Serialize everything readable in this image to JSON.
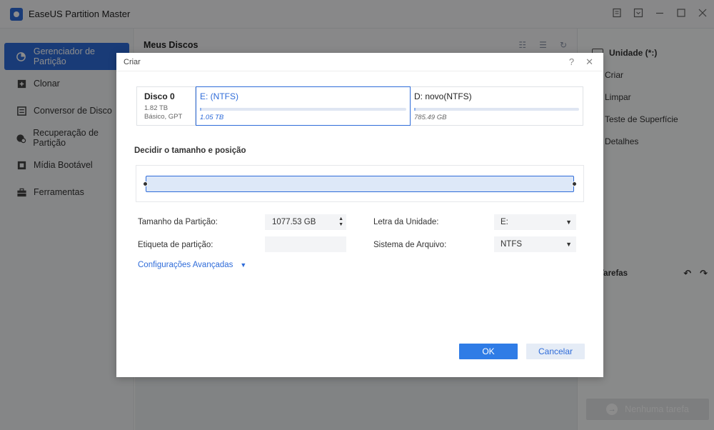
{
  "app": {
    "title": "EaseUS Partition Master"
  },
  "sidebar": {
    "items": [
      {
        "label": "Gerenciador de Partição",
        "icon": "partition-manager-icon",
        "active": true
      },
      {
        "label": "Clonar",
        "icon": "clone-icon"
      },
      {
        "label": "Conversor de Disco",
        "icon": "disk-converter-icon"
      },
      {
        "label": "Recuperação de Partição",
        "icon": "partition-recovery-icon"
      },
      {
        "label": "Mídia Bootável",
        "icon": "bootable-media-icon"
      },
      {
        "label": "Ferramentas",
        "icon": "toolbox-icon"
      }
    ]
  },
  "main": {
    "title": "Meus Discos"
  },
  "right_panel": {
    "header": "Unidade (*:)",
    "actions": [
      "Criar",
      "Limpar",
      "Teste de Superfície",
      "Detalhes"
    ],
    "tasks_label": "Tarefas",
    "no_task_button": "Nenhuma tarefa"
  },
  "dialog": {
    "title": "Criar",
    "disk": {
      "name": "Disco 0",
      "size": "1.82 TB",
      "type": "Básico, GPT"
    },
    "partitions": [
      {
        "name": "E: (NTFS)",
        "size": "1.05 TB",
        "selected": true
      },
      {
        "name": "D: novo(NTFS)",
        "size": "785.49 GB",
        "selected": false
      }
    ],
    "section_title": "Decidir o tamanho e posição",
    "fields": {
      "partition_size_label": "Tamanho da Partição:",
      "partition_size_value": "1077.53 GB",
      "partition_label_label": "Etiqueta de partição:",
      "partition_label_value": "",
      "drive_letter_label": "Letra da Unidade:",
      "drive_letter_value": "E:",
      "file_system_label": "Sistema de Arquivo:",
      "file_system_value": "NTFS"
    },
    "advanced_link": "Configurações Avançadas",
    "ok_button": "OK",
    "cancel_button": "Cancelar"
  },
  "colors": {
    "accent": "#2f6cd9",
    "ok_button": "#2f7ce6",
    "overlay": "rgba(0,0,0,0.45)"
  }
}
